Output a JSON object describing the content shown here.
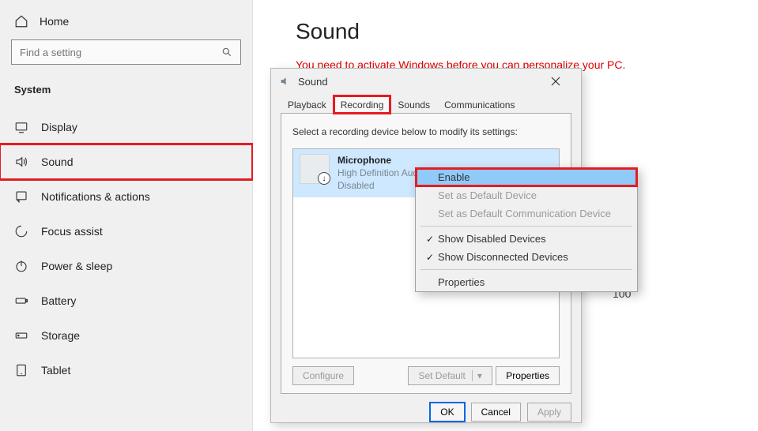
{
  "sidebar": {
    "home": "Home",
    "search_placeholder": "Find a setting",
    "section": "System",
    "items": [
      {
        "key": "display",
        "label": "Display"
      },
      {
        "key": "sound",
        "label": "Sound"
      },
      {
        "key": "notifications",
        "label": "Notifications & actions"
      },
      {
        "key": "focus-assist",
        "label": "Focus assist"
      },
      {
        "key": "power-sleep",
        "label": "Power & sleep"
      },
      {
        "key": "battery",
        "label": "Battery"
      },
      {
        "key": "storage",
        "label": "Storage"
      },
      {
        "key": "tablet",
        "label": "Tablet"
      }
    ]
  },
  "main": {
    "title": "Sound",
    "activation_msg": "You need to activate Windows before you can personalize your PC.",
    "value_right": "100"
  },
  "dialog": {
    "title": "Sound",
    "tabs": {
      "playback": "Playback",
      "recording": "Recording",
      "sounds": "Sounds",
      "communications": "Communications"
    },
    "instruction": "Select a recording device below to modify its settings:",
    "device": {
      "name": "Microphone",
      "subtitle": "High Definition Audio Device",
      "status": "Disabled"
    },
    "buttons": {
      "configure": "Configure",
      "set_default": "Set Default",
      "properties": "Properties",
      "ok": "OK",
      "cancel": "Cancel",
      "apply": "Apply"
    }
  },
  "context_menu": {
    "enable": "Enable",
    "set_default": "Set as Default Device",
    "set_comm_default": "Set as Default Communication Device",
    "show_disabled": "Show Disabled Devices",
    "show_disconnected": "Show Disconnected Devices",
    "properties": "Properties"
  }
}
